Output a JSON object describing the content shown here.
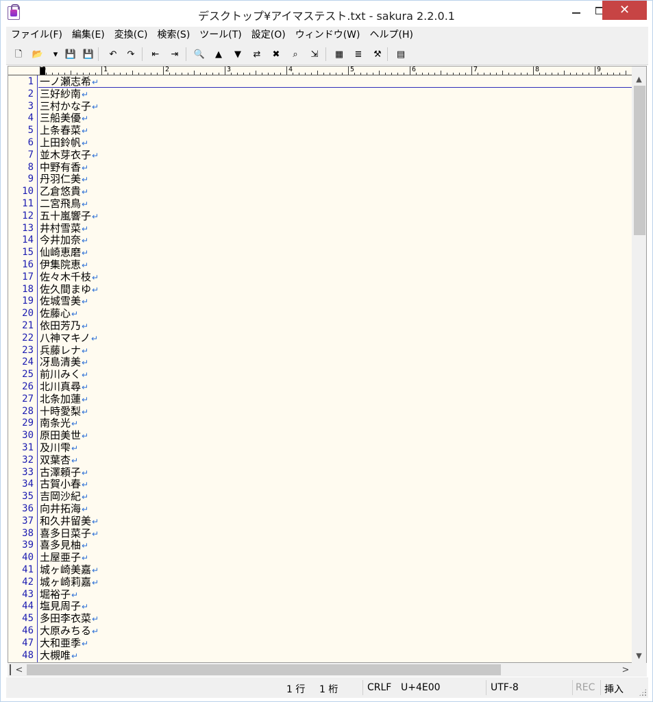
{
  "window": {
    "title": "デスクトップ¥アイマステスト.txt - sakura 2.2.0.1",
    "close_glyph": "✕"
  },
  "menu": [
    "ファイル(F)",
    "編集(E)",
    "変換(C)",
    "検索(S)",
    "ツール(T)",
    "設定(O)",
    "ウィンドウ(W)",
    "ヘルプ(H)"
  ],
  "toolbar": {
    "buttons": [
      {
        "name": "new-file-icon",
        "glyph": "🗋"
      },
      {
        "name": "open-folder-icon",
        "glyph": "📂"
      },
      {
        "name": "open-dropdown-icon",
        "glyph": "▾"
      },
      {
        "name": "save-icon",
        "glyph": "💾"
      },
      {
        "name": "save-as-icon",
        "glyph": "💾"
      },
      {
        "name": "undo-icon",
        "glyph": "↶"
      },
      {
        "name": "redo-icon",
        "glyph": "↷"
      },
      {
        "name": "jump-back-icon",
        "glyph": "⇤"
      },
      {
        "name": "jump-forward-icon",
        "glyph": "⇥"
      },
      {
        "name": "search-icon",
        "glyph": "🔍"
      },
      {
        "name": "search-prev-icon",
        "glyph": "▲"
      },
      {
        "name": "search-next-icon",
        "glyph": "▼"
      },
      {
        "name": "replace-icon",
        "glyph": "⇄"
      },
      {
        "name": "clear-highlight-icon",
        "glyph": "✖"
      },
      {
        "name": "grep-icon",
        "glyph": "⌕"
      },
      {
        "name": "jump-tag-icon",
        "glyph": "⇲"
      },
      {
        "name": "compare-icon",
        "glyph": "▦"
      },
      {
        "name": "outline-icon",
        "glyph": "≣"
      },
      {
        "name": "tool-icon",
        "glyph": "⚒"
      },
      {
        "name": "settings-icon",
        "glyph": "▤"
      }
    ]
  },
  "ruler": {
    "labels": [
      "0",
      "1",
      "2",
      "3",
      "4",
      "5",
      "6",
      "7",
      "8",
      "9"
    ]
  },
  "editor": {
    "eol_glyph": "↵",
    "lines": [
      "一ノ瀬志希",
      "三好紗南",
      "三村かな子",
      "三船美優",
      "上条春菜",
      "上田鈴帆",
      "並木芽衣子",
      "中野有香",
      "丹羽仁美",
      "乙倉悠貴",
      "二宮飛鳥",
      "五十嵐響子",
      "井村雪菜",
      "今井加奈",
      "仙崎恵磨",
      "伊集院恵",
      "佐々木千枝",
      "佐久間まゆ",
      "佐城雪美",
      "佐藤心",
      "依田芳乃",
      "八神マキノ",
      "兵藤レナ",
      "冴島清美",
      "前川みく",
      "北川真尋",
      "北条加蓮",
      "十時愛梨",
      "南条光",
      "原田美世",
      "及川雫",
      "双葉杏",
      "古澤頼子",
      "古賀小春",
      "吉岡沙紀",
      "向井拓海",
      "和久井留美",
      "喜多日菜子",
      "喜多見柚",
      "土屋亜子",
      "城ヶ崎美嘉",
      "城ヶ崎莉嘉",
      "堀裕子",
      "塩見周子",
      "多田李衣菜",
      "大原みちる",
      "大和亜季",
      "大槻唯"
    ]
  },
  "scrollbars": {
    "up": "▲",
    "down": "▼",
    "left": "<",
    "right": ">"
  },
  "status": {
    "row": "1 行",
    "col": "1 桁",
    "eol": "CRLF",
    "codepoint": "U+4E00",
    "encoding": "UTF-8",
    "rec": "REC",
    "mode": "挿入"
  }
}
